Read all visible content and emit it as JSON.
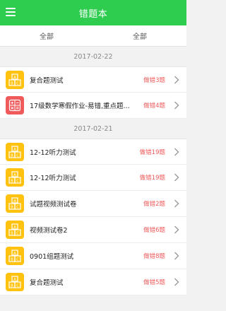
{
  "header": {
    "title": "错题本",
    "menu_icon": "hamburger-menu-icon"
  },
  "filters": [
    {
      "label": "全部"
    },
    {
      "label": "全部"
    }
  ],
  "colors": {
    "header": "#2ecc4f",
    "count": "#f05a5a",
    "icon_yellow": "#ffc20e",
    "icon_red": "#f05a5a"
  },
  "groups": [
    {
      "date": "2017-02-22",
      "items": [
        {
          "name": "复合题测试",
          "count": "做错3题",
          "icon": "abc-blocks-icon",
          "icon_color": "yellow"
        },
        {
          "name": "17级数学寒假作业-易错,重点题...",
          "count": "做错4题",
          "icon": "calculator-icon",
          "icon_color": "red"
        }
      ]
    },
    {
      "date": "2017-02-21",
      "items": [
        {
          "name": "12-12听力测试",
          "count": "做错19题",
          "icon": "abc-blocks-icon",
          "icon_color": "yellow"
        },
        {
          "name": "12-12听力测试",
          "count": "做错19题",
          "icon": "abc-blocks-icon",
          "icon_color": "yellow"
        },
        {
          "name": "试题视频测试卷",
          "count": "做错2题",
          "icon": "abc-blocks-icon",
          "icon_color": "yellow"
        },
        {
          "name": "视频测试卷2",
          "count": "做错6题",
          "icon": "abc-blocks-icon",
          "icon_color": "yellow"
        },
        {
          "name": "0901组题测试",
          "count": "做错8题",
          "icon": "abc-blocks-icon",
          "icon_color": "yellow"
        },
        {
          "name": "复合题测试",
          "count": "做错5题",
          "icon": "abc-blocks-icon",
          "icon_color": "yellow"
        }
      ]
    }
  ]
}
